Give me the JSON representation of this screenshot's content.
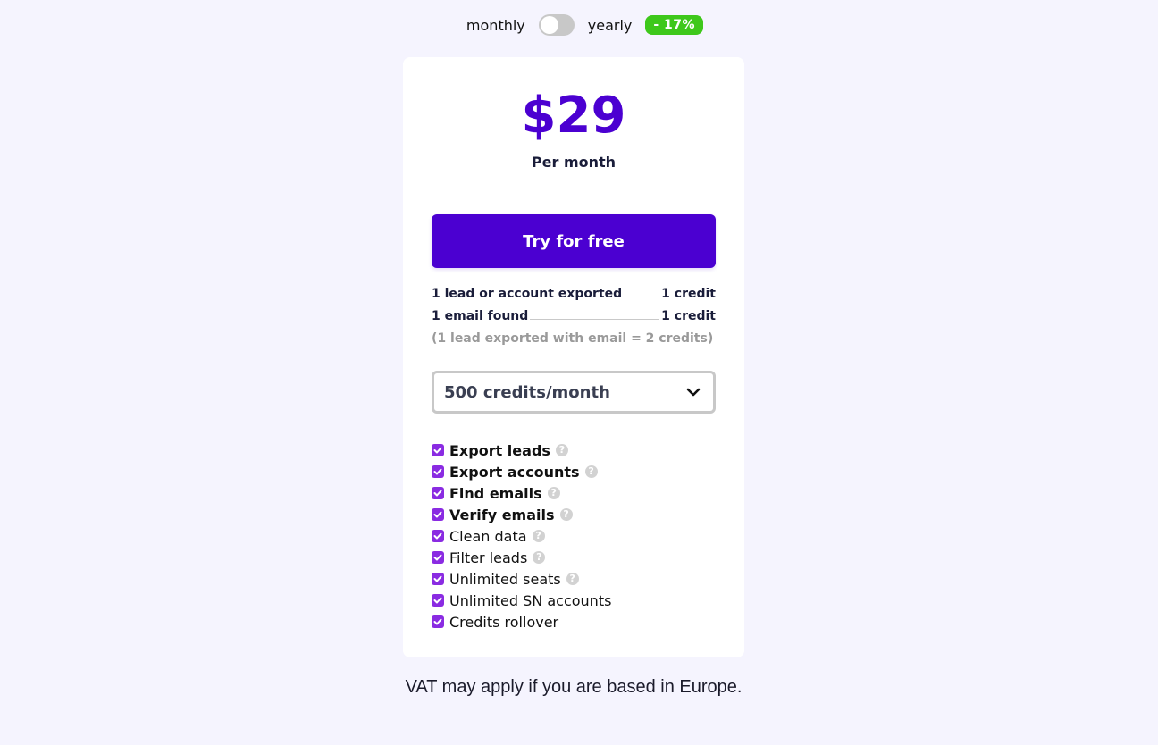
{
  "billing": {
    "monthly_label": "monthly",
    "yearly_label": "yearly",
    "yearly_selected": false,
    "discount_badge": "- 17%"
  },
  "plan": {
    "price": "$29",
    "period": "Per month",
    "cta_label": "Try for free"
  },
  "credit_rules": {
    "rows": [
      {
        "action": "1 lead or account exported",
        "cost": "1 credit"
      },
      {
        "action": "1 email found",
        "cost": "1 credit"
      }
    ],
    "note": "(1 lead exported with email = 2 credits)"
  },
  "credits_select": {
    "value": "500 credits/month",
    "icon": "chevron-down-icon"
  },
  "features": [
    {
      "label": "Export leads",
      "bold": true,
      "checked": true,
      "help": true
    },
    {
      "label": "Export accounts",
      "bold": true,
      "checked": true,
      "help": true
    },
    {
      "label": "Find emails",
      "bold": true,
      "checked": true,
      "help": true
    },
    {
      "label": "Verify emails",
      "bold": true,
      "checked": true,
      "help": true
    },
    {
      "label": "Clean data",
      "bold": false,
      "checked": true,
      "help": true
    },
    {
      "label": "Filter leads",
      "bold": false,
      "checked": true,
      "help": true
    },
    {
      "label": "Unlimited seats",
      "bold": false,
      "checked": true,
      "help": true
    },
    {
      "label": "Unlimited SN accounts",
      "bold": false,
      "checked": true,
      "help": false
    },
    {
      "label": "Credits rollover",
      "bold": false,
      "checked": true,
      "help": false
    }
  ],
  "help_glyph": "?",
  "footer_note": "VAT may apply if you are based in Europe.",
  "colors": {
    "accent": "#4b00d1",
    "checkbox": "#8a2be2",
    "discount": "#3ec81b",
    "background": "#f5f4fe"
  }
}
